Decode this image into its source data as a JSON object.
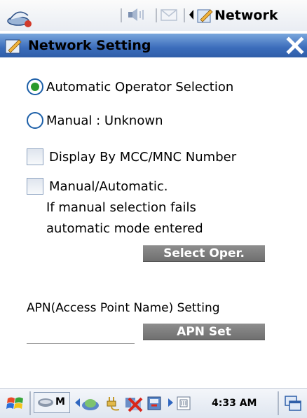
{
  "statusbar": {
    "start_icon": "windows-satellite-icon",
    "title": "Network",
    "icons": [
      "volume-muted-icon",
      "mail-icon",
      "back-arrow-icon",
      "network-app-icon"
    ]
  },
  "titlebar": {
    "title": "Network Setting",
    "close_icon": "close-icon"
  },
  "form": {
    "auto_operator_label": "Automatic Operator Selection",
    "auto_operator_selected": true,
    "manual_label": "Manual : Unknown",
    "manual_selected": false,
    "display_mcc_label": "Display By MCC/MNC Number",
    "display_mcc_checked": false,
    "manual_auto_label": "Manual/Automatic.",
    "manual_auto_checked": false,
    "note_line1": "If manual selection fails",
    "note_line2": "automatic mode entered",
    "select_oper_button": "Select Oper.",
    "apn_label": "APN(Access Point Name) Setting",
    "apn_value": "",
    "apn_set_button": "APN Set"
  },
  "taskbar": {
    "time": "4:33 AM",
    "icons": [
      "start-flag-icon",
      "drive-m-icon",
      "network-globe-icon",
      "power-plug-icon",
      "no-connection-icon",
      "phone-icon",
      "battery-icon",
      "window-switch-icon"
    ],
    "drive_label": "M"
  },
  "colors": {
    "titlebar_blue": "#3b6cbb",
    "radio_selected_green": "#2a9a2a",
    "button_gray": "#7a7a7a"
  }
}
